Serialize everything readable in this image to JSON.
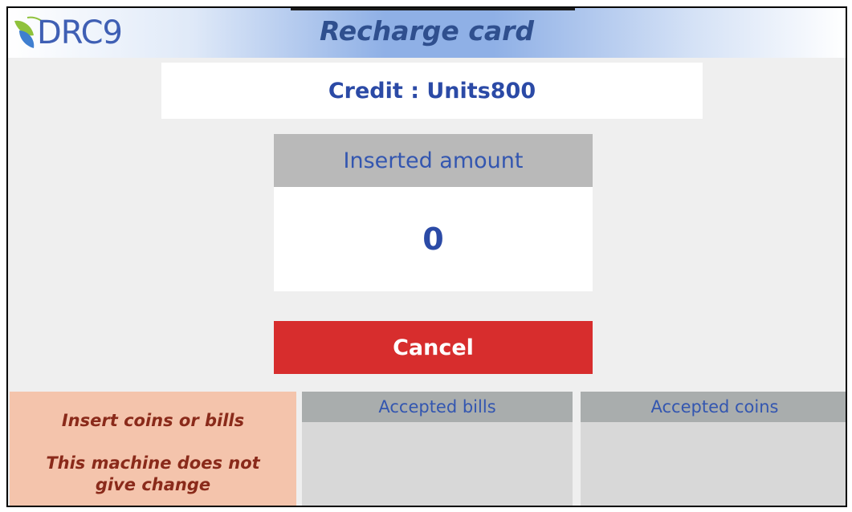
{
  "header": {
    "logo_text": "DRC9",
    "title": "Recharge card"
  },
  "credit": {
    "text": "Credit : Units800"
  },
  "inserted": {
    "label": "Inserted amount",
    "value": "0"
  },
  "actions": {
    "cancel_label": "Cancel"
  },
  "info": {
    "line1": "Insert coins or bills",
    "line2": "This machine does not give change"
  },
  "accepted": {
    "bills_label": "Accepted bills",
    "coins_label": "Accepted coins"
  },
  "colors": {
    "accent_blue": "#2b4aa6",
    "cancel_red": "#d72d2d",
    "info_bg": "#f4c4ac",
    "info_text": "#8a2a1a"
  }
}
